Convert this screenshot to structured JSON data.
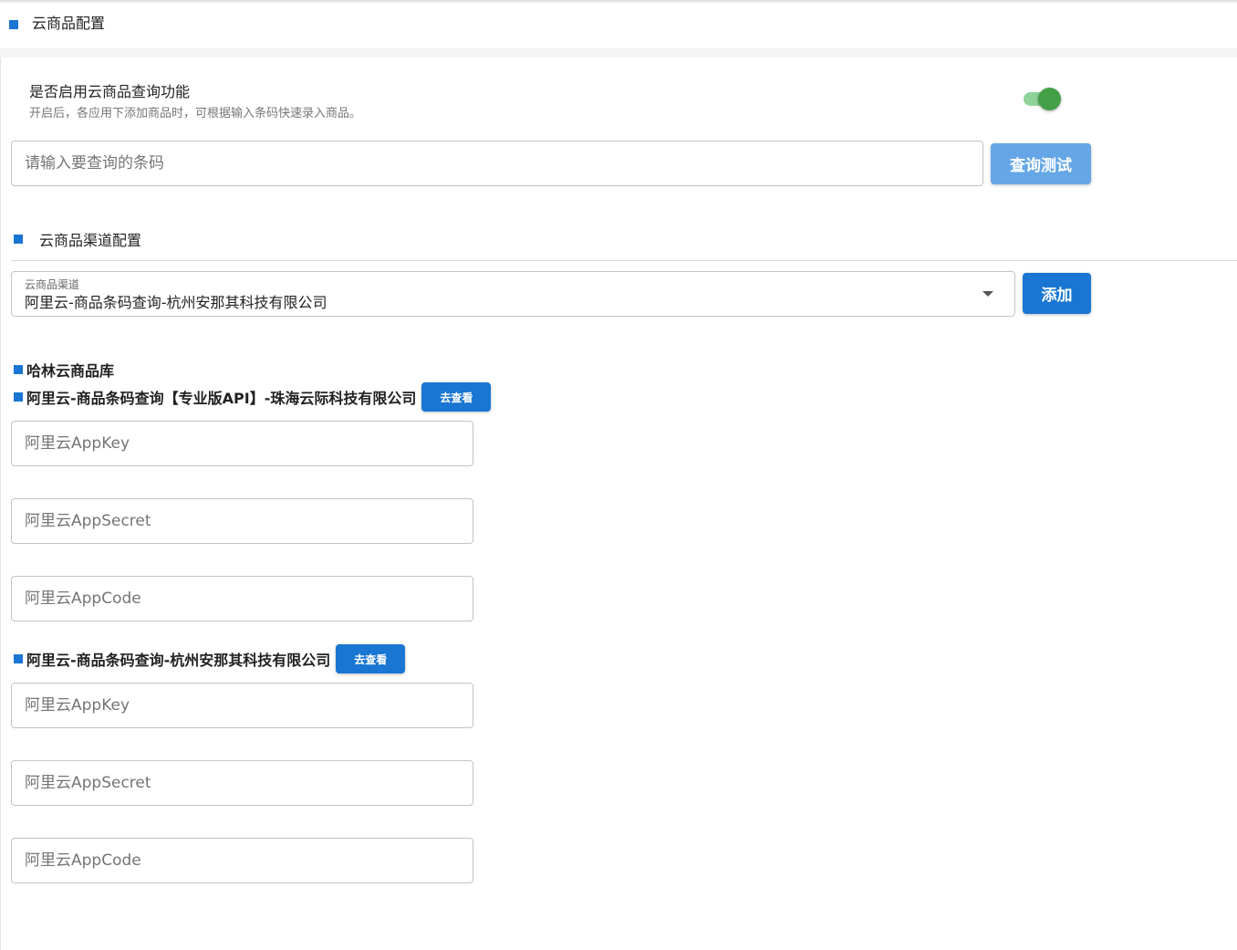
{
  "header": {
    "title": "云商品配置"
  },
  "enable_setting": {
    "title": "是否启用云商品查询功能",
    "description": "开启后，各应用下添加商品时，可根据输入条码快速录入商品。",
    "enabled": true,
    "accent_color": "#43a047"
  },
  "barcode_test": {
    "placeholder": "请输入要查询的条码",
    "value": "",
    "button_label": "查询测试"
  },
  "channel_section": {
    "title": "云商品渠道配置",
    "select_label": "云商品渠道",
    "select_value": "阿里云-商品条码查询-杭州安那其科技有限公司",
    "add_label": "添加"
  },
  "channels": [
    {
      "title": "哈林云商品库"
    },
    {
      "title": "阿里云-商品条码查询【专业版API】-珠海云际科技有限公司",
      "link_label": "去查看",
      "fields": [
        {
          "placeholder": "阿里云AppKey",
          "value": ""
        },
        {
          "placeholder": "阿里云AppSecret",
          "value": ""
        },
        {
          "placeholder": "阿里云AppCode",
          "value": ""
        }
      ]
    },
    {
      "title": "阿里云-商品条码查询-杭州安那其科技有限公司",
      "link_label": "去查看",
      "fields": [
        {
          "placeholder": "阿里云AppKey",
          "value": ""
        },
        {
          "placeholder": "阿里云AppSecret",
          "value": ""
        },
        {
          "placeholder": "阿里云AppCode",
          "value": ""
        }
      ]
    }
  ],
  "colors": {
    "primary": "#1976d2",
    "primary_light": "#64a6e6",
    "border": "#c4c4c4"
  }
}
